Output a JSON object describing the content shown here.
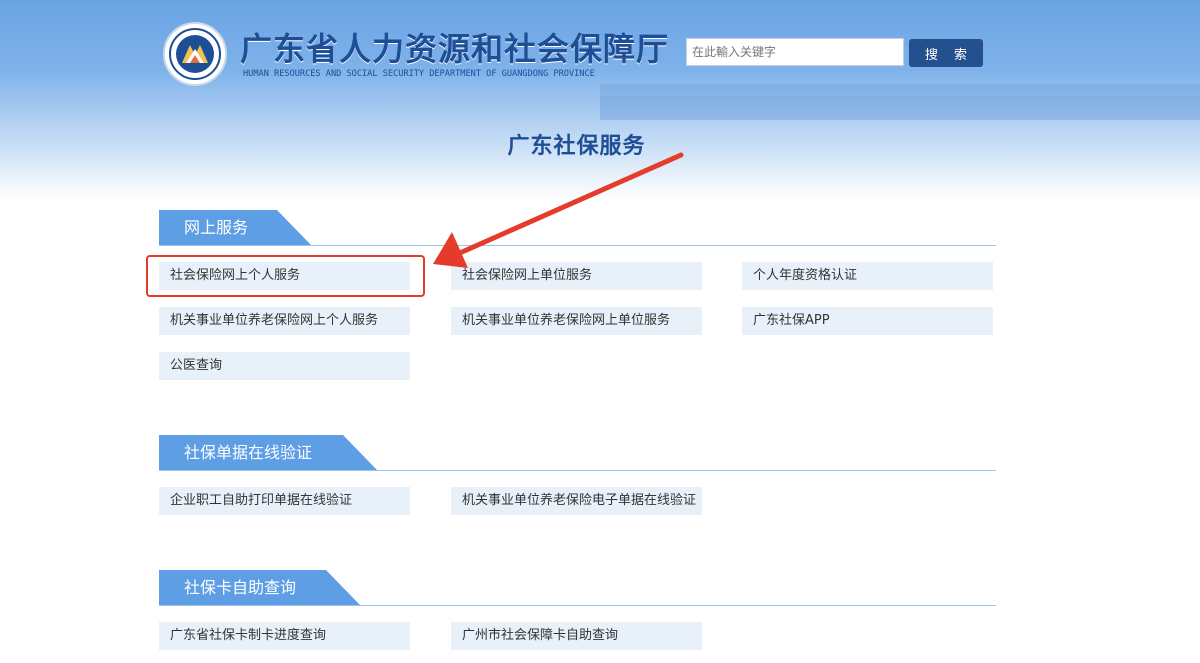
{
  "header": {
    "site_title": "广东省人力资源和社会保障厅",
    "site_subtitle": "HUMAN RESOURCES AND SOCIAL SECURITY DEPARTMENT OF GUANGDONG PROVINCE",
    "search": {
      "placeholder": "在此輸入关键字",
      "button_label": "搜 索"
    }
  },
  "page_title": "广东社保服务",
  "sections": [
    {
      "title": "网上服务",
      "items": [
        "社会保险网上个人服务",
        "社会保险网上单位服务",
        "个人年度资格认证",
        "机关事业单位养老保险网上个人服务",
        "机关事业单位养老保险网上单位服务",
        "广东社保APP",
        "公医查询"
      ]
    },
    {
      "title": "社保单据在线验证",
      "items": [
        "企业职工自助打印单据在线验证",
        "机关事业单位养老保险电子单据在线验证"
      ]
    },
    {
      "title": "社保卡自助查询",
      "items": [
        "广东省社保卡制卡进度查询",
        "广州市社会保障卡自助查询"
      ]
    }
  ],
  "colors": {
    "accent_blue": "#5d9ee4",
    "title_blue": "#1d4e96",
    "item_background": "#e8f1fa",
    "annotation_red": "#e53b2a"
  },
  "icons": [
    "department-emblem-icon"
  ]
}
